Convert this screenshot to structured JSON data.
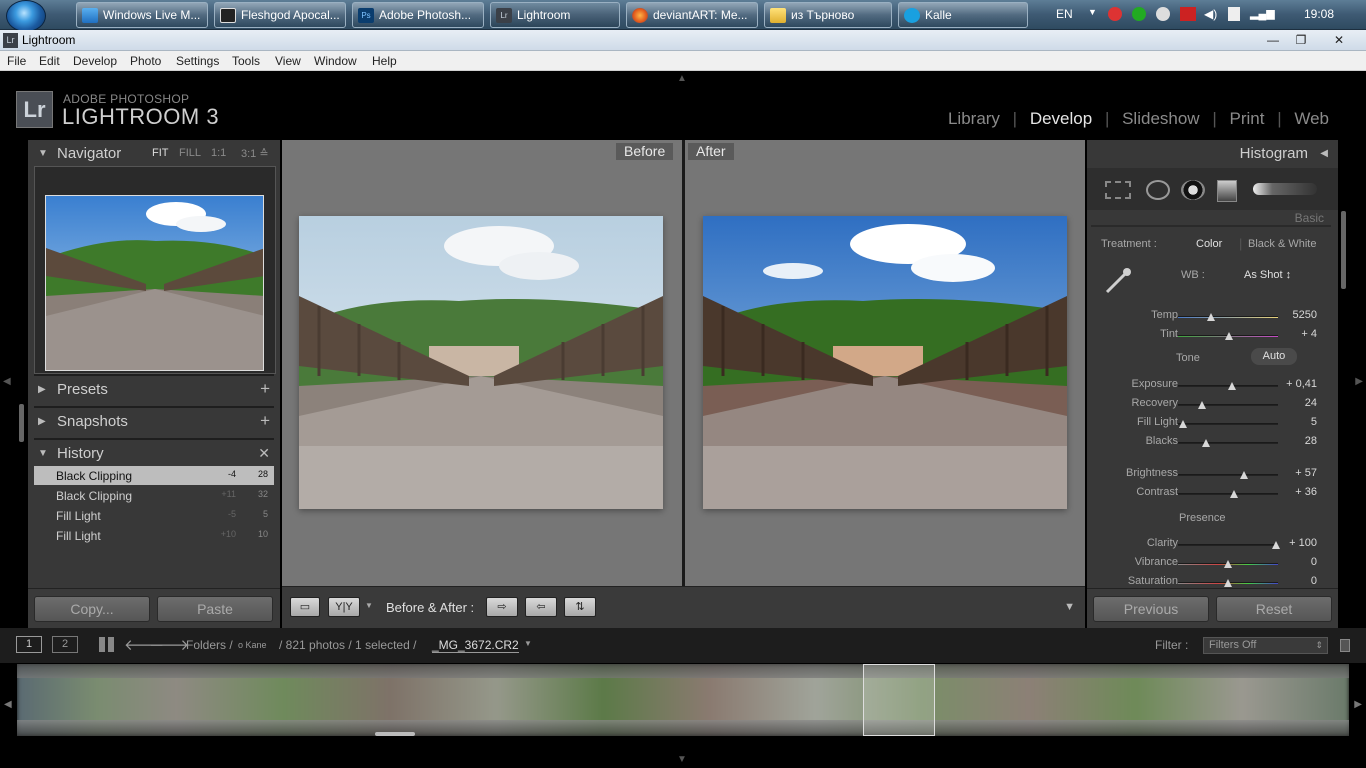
{
  "taskbar": {
    "buttons": [
      {
        "label": "Windows Live M..."
      },
      {
        "label": "Fleshgod Apocal..."
      },
      {
        "label": "Adobe Photosh..."
      },
      {
        "label": "Lightroom"
      },
      {
        "label": "deviantART: Me..."
      },
      {
        "label": "из Търново"
      },
      {
        "label": "Kalle"
      }
    ],
    "language": "EN",
    "clock": "19:08"
  },
  "window": {
    "title": "Lightroom",
    "app_icon": "Lr"
  },
  "menu": [
    "File",
    "Edit",
    "Develop",
    "Photo",
    "Settings",
    "Tools",
    "View",
    "Window",
    "Help"
  ],
  "lightroom": {
    "logo": "Lr",
    "brand_line1": "ADOBE PHOTOSHOP",
    "brand_line2": "LIGHTROOM 3",
    "modules": [
      "Library",
      "Develop",
      "Slideshow",
      "Print",
      "Web"
    ],
    "active_module": "Develop"
  },
  "navigator": {
    "title": "Navigator",
    "zoom": [
      "FIT",
      "FILL",
      "1:1",
      "3:1 ≙"
    ]
  },
  "presets": {
    "title": "Presets"
  },
  "snapshots": {
    "title": "Snapshots"
  },
  "history": {
    "title": "History",
    "items": [
      {
        "label": "Black Clipping",
        "a": "-4",
        "b": "28"
      },
      {
        "label": "Black Clipping",
        "a": "+11",
        "b": "32"
      },
      {
        "label": "Fill Light",
        "a": "-5",
        "b": "5"
      },
      {
        "label": "Fill Light",
        "a": "+10",
        "b": "10"
      }
    ]
  },
  "left_buttons": {
    "copy": "Copy...",
    "paste": "Paste"
  },
  "compare": {
    "before": "Before",
    "after": "After"
  },
  "toolbar": {
    "view_mode": "Y|Y",
    "before_after_label": "Before & After :"
  },
  "histogram": {
    "title": "Histogram"
  },
  "basic": {
    "title": "Basic",
    "treatment_label": "Treatment :",
    "treatment_color": "Color",
    "treatment_bw": "Black & White",
    "wb_label": "WB :",
    "wb_value": "As Shot ↕",
    "tone_label": "Tone",
    "auto": "Auto",
    "presence_label": "Presence",
    "sliders": [
      {
        "name": "Temp",
        "value": "5250",
        "pos": 0.33
      },
      {
        "name": "Tint",
        "value": "+ 4",
        "pos": 0.51
      },
      {
        "name": "Exposure",
        "value": "+ 0,41",
        "pos": 0.54
      },
      {
        "name": "Recovery",
        "value": "24",
        "pos": 0.24
      },
      {
        "name": "Fill Light",
        "value": "5",
        "pos": 0.05
      },
      {
        "name": "Blacks",
        "value": "28",
        "pos": 0.28
      },
      {
        "name": "Brightness",
        "value": "+ 57",
        "pos": 0.66
      },
      {
        "name": "Contrast",
        "value": "+ 36",
        "pos": 0.56
      },
      {
        "name": "Clarity",
        "value": "+ 100",
        "pos": 0.98
      },
      {
        "name": "Vibrance",
        "value": "0",
        "pos": 0.5
      },
      {
        "name": "Saturation",
        "value": "0",
        "pos": 0.5
      }
    ]
  },
  "right_buttons": {
    "previous": "Previous",
    "reset": "Reset"
  },
  "filmstrip_bar": {
    "page1": "1",
    "page2": "2",
    "folders": "Folders /",
    "folder_name": "o Kane",
    "count": "/ 821 photos / 1 selected /",
    "filename": "_MG_3672.CR2",
    "filter_label": "Filter :",
    "filter_value": "Filters Off"
  },
  "colors": {
    "lr_bg": "#000000",
    "panel": "#383838",
    "center": "#767676",
    "selected_history": "#bdbdbd"
  }
}
